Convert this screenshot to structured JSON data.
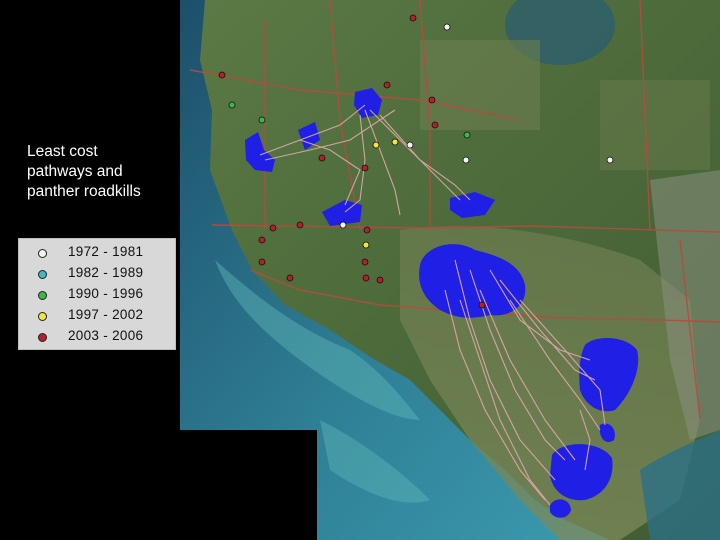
{
  "caption": {
    "line1": "Least cost",
    "line2": "pathways and",
    "line3": "panther roadkills"
  },
  "legend": {
    "items": [
      {
        "label": "1972 - 1981",
        "color": "#f2f2f2"
      },
      {
        "label": "1982 - 1989",
        "color": "#46b7c9"
      },
      {
        "label": "1990 - 1996",
        "color": "#3bb84a"
      },
      {
        "label": "1997 - 2002",
        "color": "#f0e442"
      },
      {
        "label": "2003 - 2006",
        "color": "#b3202a"
      }
    ]
  },
  "colors": {
    "habitat_patch": "#1f1fe6",
    "pathway": "#d9a7a7",
    "road": "#b84a3c",
    "sea": "#2e6f86",
    "land": "#4b6e3a"
  }
}
